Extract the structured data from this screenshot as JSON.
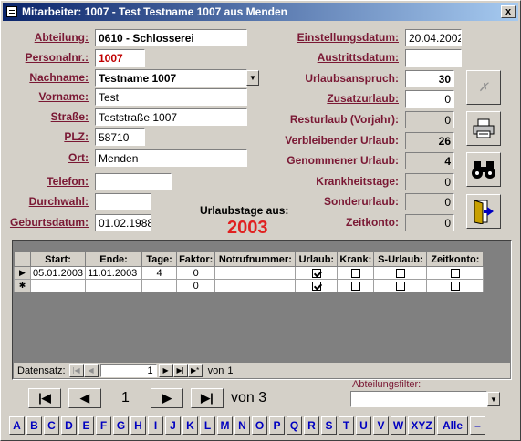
{
  "window": {
    "title": "Mitarbeiter: 1007 - Test Testname 1007 aus Menden",
    "close_label": "x"
  },
  "form": {
    "abteilung": {
      "label": "Abteilung:",
      "value": "0610 - Schlosserei"
    },
    "personalnr": {
      "label": "Personalnr.:",
      "value": "1007"
    },
    "nachname": {
      "label": "Nachname:",
      "value": "Testname 1007"
    },
    "vorname": {
      "label": "Vorname:",
      "value": "Test"
    },
    "strasse": {
      "label": "Straße:",
      "value": "Teststraße 1007"
    },
    "plz": {
      "label": "PLZ:",
      "value": "58710"
    },
    "ort": {
      "label": "Ort:",
      "value": "Menden"
    },
    "telefon": {
      "label": "Telefon:",
      "value": ""
    },
    "durchwahl": {
      "label": "Durchwahl:",
      "value": ""
    },
    "geburtsdatum": {
      "label": "Geburtsdatum:",
      "value": "01.02.1988"
    },
    "einstellungsdatum": {
      "label": "Einstellungsdatum:",
      "value": "20.04.2002"
    },
    "austrittsdatum": {
      "label": "Austrittsdatum:",
      "value": ""
    },
    "urlaubsanspruch": {
      "label": "Urlaubsanspruch:",
      "value": "30"
    },
    "zusatzurlaub": {
      "label": "Zusatzurlaub:",
      "value": "0"
    },
    "resturlaub": {
      "label": "Resturlaub (Vorjahr):",
      "value": "0"
    },
    "verbleibender": {
      "label": "Verbleibender Urlaub:",
      "value": "26"
    },
    "genommener": {
      "label": "Genommener Urlaub:",
      "value": "4"
    },
    "krankheitstage": {
      "label": "Krankheitstage:",
      "value": "0"
    },
    "sonderurlaub": {
      "label": "Sonderurlaub:",
      "value": "0"
    },
    "zeitkonto": {
      "label": "Zeitkonto:",
      "value": "0"
    }
  },
  "urlaub": {
    "heading": "Urlaubstage aus:",
    "year": "2003"
  },
  "grid": {
    "columns": [
      "Start:",
      "Ende:",
      "Tage:",
      "Faktor:",
      "Notrufnummer:",
      "Urlaub:",
      "Krank:",
      "S-Urlaub:",
      "Zeitkonto:"
    ],
    "rows": [
      {
        "start": "05.01.2003",
        "ende": "11.01.2003",
        "tage": "4",
        "faktor": "0",
        "notruf": "",
        "urlaub": true,
        "krank": false,
        "surlaub": false,
        "zeitkonto": false
      },
      {
        "start": "",
        "ende": "",
        "tage": "",
        "faktor": "0",
        "notruf": "",
        "urlaub": true,
        "krank": false,
        "surlaub": false,
        "zeitkonto": false
      }
    ],
    "nav": {
      "label": "Datensatz:",
      "current": "1",
      "of_label": "von",
      "total": "1"
    }
  },
  "record_nav": {
    "current": "1",
    "of_text": "von 3"
  },
  "filter": {
    "label": "Abteilungsfilter:",
    "value": ""
  },
  "alphabet": [
    "A",
    "B",
    "C",
    "D",
    "E",
    "F",
    "G",
    "H",
    "I",
    "J",
    "K",
    "L",
    "M",
    "N",
    "O",
    "P",
    "Q",
    "R",
    "S",
    "T",
    "U",
    "V",
    "W",
    "XYZ",
    "Alle",
    "–"
  ]
}
